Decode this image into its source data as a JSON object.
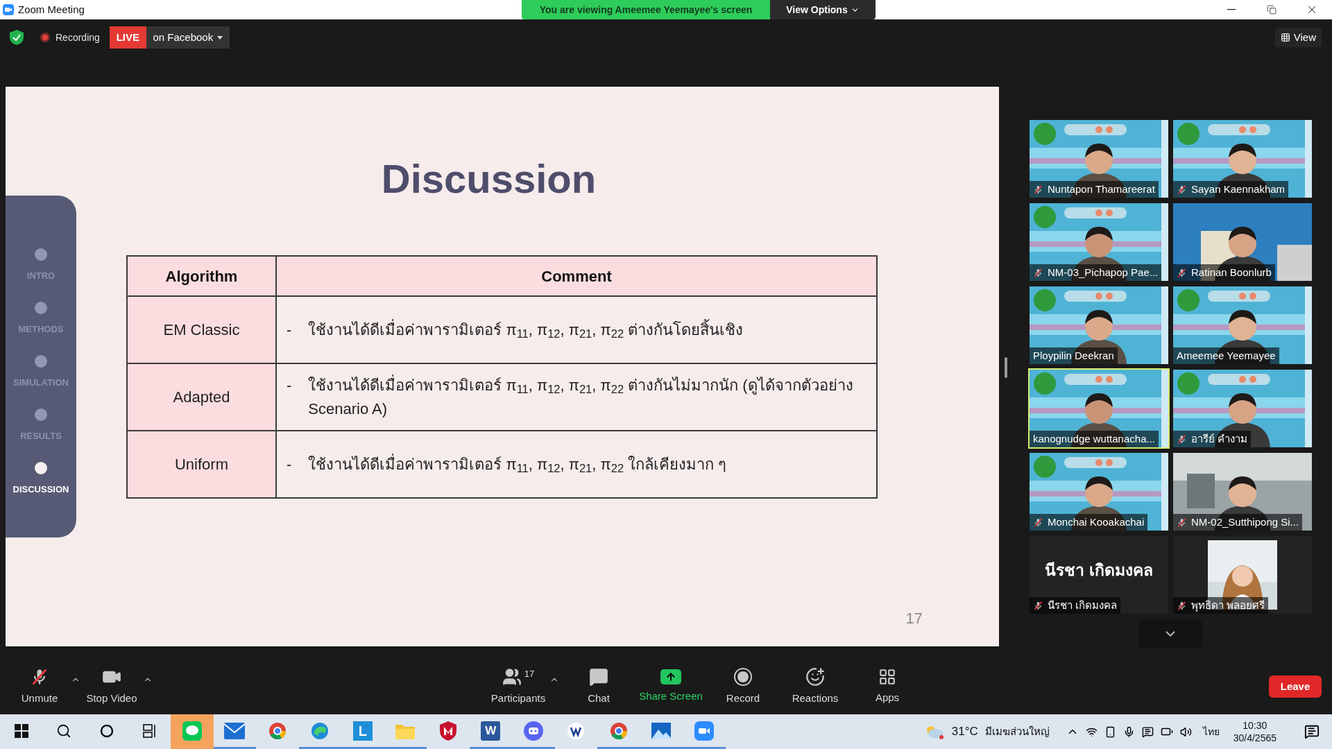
{
  "window": {
    "title": "Zoom Meeting",
    "banner": "You are viewing Ameemee Yeemayee's screen",
    "view_options": "View Options"
  },
  "meeting_bar": {
    "recording": "Recording",
    "live": "LIVE",
    "live_target": "on Facebook",
    "view": "View"
  },
  "slide": {
    "title": "Discussion",
    "nav": [
      {
        "label": "INTRO",
        "selected": false
      },
      {
        "label": "METHODS",
        "selected": false
      },
      {
        "label": "SIMULATION",
        "selected": false
      },
      {
        "label": "RESULTS",
        "selected": false
      },
      {
        "label": "DISCUSSION",
        "selected": true
      }
    ],
    "table": {
      "columns": [
        "Algorithm",
        "Comment"
      ],
      "rows": [
        {
          "algorithm": "EM Classic",
          "bullet": "-",
          "comment": "ใช้งานได้ดีเมื่อค่าพารามิเตอร์ π$_{11}$, π$_{12}$, π$_{21}$, π$_{22}$ ต่างกันโดยสิ้นเชิง"
        },
        {
          "algorithm": "Adapted",
          "bullet": "-",
          "comment": "ใช้งานได้ดีเมื่อค่าพารามิเตอร์ π$_{11}$, π$_{12}$, π$_{21}$, π$_{22}$ ต่างกันไม่มากนัก (ดูได้จากตัวอย่าง Scenario A)"
        },
        {
          "algorithm": "Uniform",
          "bullet": "-",
          "comment": "ใช้งานได้ดีเมื่อค่าพารามิเตอร์ π$_{11}$, π$_{12}$, π$_{21}$, π$_{22}$ ใกล้เคียงมาก ๆ"
        }
      ]
    },
    "page_number": "17"
  },
  "participants": [
    {
      "kind": "video",
      "name": "Nuntapon Thamareerat",
      "muted": true,
      "speaking": false
    },
    {
      "kind": "video",
      "name": "Sayan Kaennakham",
      "muted": true,
      "speaking": false
    },
    {
      "kind": "video",
      "name": "NM-03_Pichapop Pae...",
      "muted": true,
      "speaking": false
    },
    {
      "kind": "video",
      "name": "Ratinan Boonlurb",
      "muted": true,
      "speaking": false
    },
    {
      "kind": "video",
      "name": "Ploypilin Deekran",
      "muted": false,
      "speaking": false
    },
    {
      "kind": "video",
      "name": "Ameemee Yeemayee",
      "muted": false,
      "speaking": false
    },
    {
      "kind": "video",
      "name": "kanognudge wuttanacha...",
      "muted": false,
      "speaking": true
    },
    {
      "kind": "video",
      "name": "อารีย์ คำงาม",
      "muted": true,
      "speaking": false
    },
    {
      "kind": "video",
      "name": "Monchai Kooakachai",
      "muted": true,
      "speaking": false
    },
    {
      "kind": "video",
      "name": "NM-02_Sutthipong Si...",
      "muted": true,
      "speaking": false
    },
    {
      "kind": "name",
      "display_name": "นีรชา เกิดมงคล",
      "name": "นีรชา เกิดมงคล",
      "muted": true,
      "speaking": false
    },
    {
      "name": "พุทธิดา พลอยศรี",
      "muted": true,
      "speaking": false
    }
  ],
  "toolbar": {
    "items": [
      {
        "kind": "unmute",
        "label": "Unmute",
        "menu": true
      },
      {
        "kind": "video",
        "label": "Stop Video",
        "menu": true
      },
      {
        "kind": "participants",
        "label": "Participants",
        "count": "17",
        "menu": true
      },
      {
        "kind": "chat",
        "label": "Chat",
        "menu": false
      },
      {
        "kind": "share",
        "label": "Share Screen",
        "menu": false
      },
      {
        "kind": "record",
        "label": "Record",
        "menu": false
      },
      {
        "kind": "reactions",
        "label": "Reactions",
        "menu": false
      },
      {
        "kind": "apps",
        "label": "Apps",
        "menu": false
      }
    ],
    "leave": "Leave"
  },
  "taskbar": {
    "apps": [
      {
        "kind": "start",
        "open": false,
        "attention": false
      },
      {
        "kind": "search",
        "open": false,
        "attention": false
      },
      {
        "kind": "cortana",
        "open": false,
        "attention": false
      },
      {
        "kind": "taskview",
        "open": false,
        "attention": false
      },
      {
        "kind": "line",
        "open": false,
        "attention": true
      },
      {
        "kind": "mail",
        "open": true,
        "attention": false
      },
      {
        "kind": "chrome",
        "open": false,
        "attention": false
      },
      {
        "kind": "edge",
        "open": true,
        "attention": false
      },
      {
        "kind": "letter",
        "label": "L",
        "open": true,
        "attention": false
      },
      {
        "kind": "folder",
        "open": true,
        "attention": false
      },
      {
        "kind": "shield",
        "open": false,
        "attention": false
      },
      {
        "kind": "word",
        "label": "W",
        "open": true,
        "attention": false
      },
      {
        "kind": "discord",
        "open": true,
        "attention": false
      },
      {
        "kind": "pen",
        "open": false,
        "attention": false
      },
      {
        "kind": "chrome",
        "open": true,
        "attention": false
      },
      {
        "kind": "photos",
        "open": true,
        "attention": false
      },
      {
        "kind": "zoom",
        "open": true,
        "attention": false
      }
    ],
    "weather": {
      "temperature": "31°C",
      "condition": "มีเมฆส่วนใหญ่"
    },
    "language": "ไทย",
    "time": "10:30",
    "date": "30/4/2565"
  }
}
